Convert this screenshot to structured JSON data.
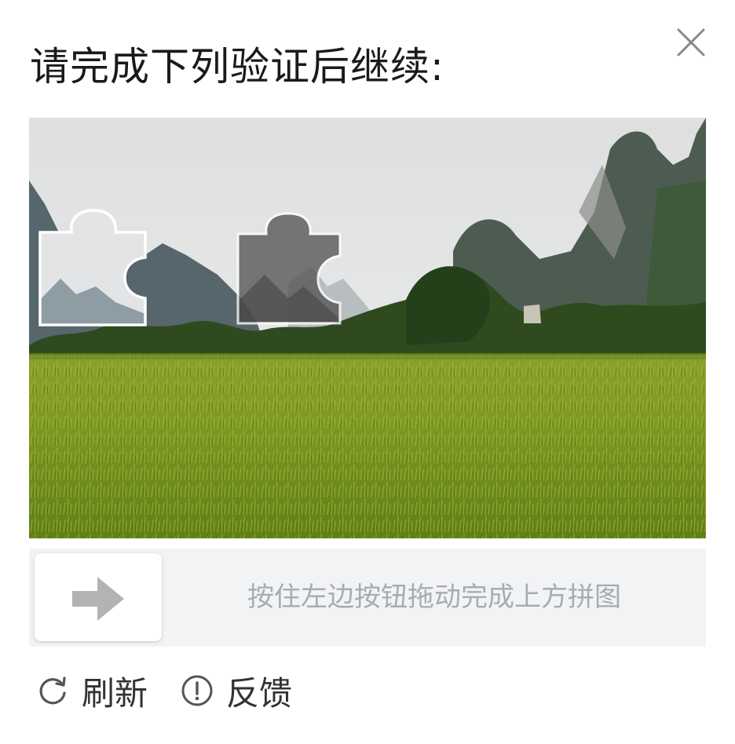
{
  "dialog": {
    "title": "请完成下列验证后继续:",
    "close_icon": "close-icon"
  },
  "captcha": {
    "image_description": "landscape-rice-field-karst-mountains",
    "slider_hint": "按住左边按钮拖动完成上方拼图",
    "slider_icon": "arrow-right-icon"
  },
  "footer": {
    "refresh_label": "刷新",
    "refresh_icon": "refresh-icon",
    "feedback_label": "反馈",
    "feedback_icon": "info-circle-icon"
  },
  "colors": {
    "slider_track": "#f2f3f5",
    "hint_text": "#a8abb1",
    "arrow": "#b3b3b3",
    "title_text": "#1a1a1a"
  }
}
